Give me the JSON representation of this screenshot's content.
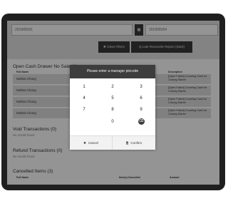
{
  "filters": {
    "date_from": "2019/05/01",
    "date_to": "2019/05/04",
    "calendar_icon": "calendar-icon",
    "clear_filters_label": "✖ Clear Filters",
    "last_report_label": "Q Last Reconcile Report (Start)"
  },
  "open_cash": {
    "title": "Open Cash Drawer No Sale (4)",
    "columns": {
      "user": "Full Name",
      "description": "Description"
    },
    "rows": [
      {
        "name": "Nathan Chung",
        "description": "[Open Failed] Counting Cash for Closing Starter"
      },
      {
        "name": "Nathan Chung",
        "description": "[Open Failed] Counting Cash for Closing Starter"
      },
      {
        "name": "Nathan Chung",
        "description": "[Open Failed] Counting Cash for Closing Starter"
      },
      {
        "name": "Nathan Chung",
        "description": "[Open Failed] Counting Cash for Closing Starter"
      }
    ]
  },
  "void": {
    "title": "Void Transactions (0)",
    "empty": "No results found"
  },
  "refund": {
    "title": "Refund Transactions (0)",
    "empty": "No results found"
  },
  "cancelled": {
    "title": "Cancelled Items (3)",
    "columns": {
      "user": "Full Name",
      "item": "Item(s) Cancelled",
      "amount": "Amount"
    }
  },
  "modal": {
    "title": "Please enter a manager pincode",
    "keys": [
      "1",
      "2",
      "3",
      "4",
      "5",
      "6",
      "7",
      "8",
      "9",
      "0"
    ],
    "backspace_icon": "⌫",
    "cancel_label": "Cancel",
    "confirm_label": "Confirm",
    "cancel_icon": "✖",
    "confirm_icon": "🗎"
  }
}
